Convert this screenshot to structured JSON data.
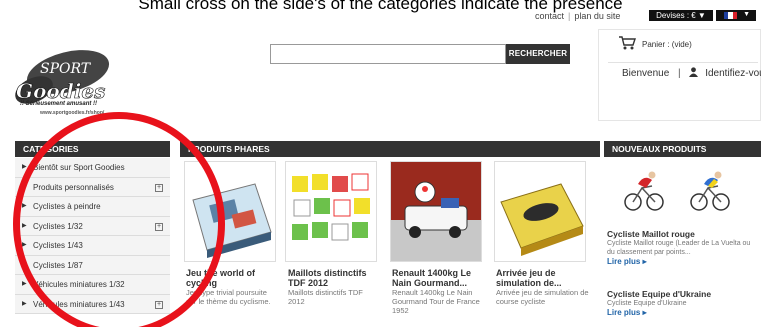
{
  "caption": "Small cross on the side's of the categories indicate the presence",
  "toplinks": {
    "contact": "contact",
    "sep": "|",
    "plan": "plan du site"
  },
  "devises": "Devises : € ▼",
  "search": {
    "placeholder": "",
    "button": "RECHERCHER"
  },
  "cart": {
    "label": "Panier : (vide)",
    "welcome": "Bienvenue",
    "signin": "Identifiez-vous"
  },
  "logo": {
    "line1": "SPORT",
    "line2": "Goodies",
    "tagline": "!! Sérieusement amusant !!",
    "url": "www.sportgoodies.fr/shop/"
  },
  "categories": {
    "title": "CATEGORIES",
    "items": [
      {
        "label": "Bientôt sur Sport Goodies",
        "plus": false
      },
      {
        "label": "Produits personnalisés",
        "plus": true
      },
      {
        "label": "Cyclistes à peindre",
        "plus": false
      },
      {
        "label": "Cyclistes 1/32",
        "plus": true
      },
      {
        "label": "Cyclistes 1/43",
        "plus": false
      },
      {
        "label": "Cyclistes 1/87",
        "plus": false
      },
      {
        "label": "Véhicules miniatures 1/32",
        "plus": false
      },
      {
        "label": "Véhicules miniatures 1/43",
        "plus": true
      }
    ]
  },
  "featured": {
    "title": "PRODUITS PHARES",
    "products": [
      {
        "title": "Jeu the world of cycling",
        "desc": "Jeu type trivial poursuite sur le thème du cyclisme."
      },
      {
        "title": "Maillots distinctifs TDF 2012",
        "desc": "Maillots distinctifs TDF 2012"
      },
      {
        "title": "Renault 1400kg Le Nain Gourmand...",
        "desc": "Renault 1400kg Le Nain Gourmand Tour de France 1952"
      },
      {
        "title": "Arrivée jeu de simulation de...",
        "desc": "Arrivée jeu de simulation de course cycliste"
      }
    ]
  },
  "newproducts": {
    "title": "NOUVEAUX PRODUITS",
    "items": [
      {
        "title": "Cycliste Maillot rouge",
        "desc": "Cycliste Maillot rouge (Leader de La Vuelta ou du classement par points...",
        "more": "Lire plus ▸"
      },
      {
        "title": "Cycliste Equipe d'Ukraine",
        "desc": "Cycliste Equipe d'Ukraine",
        "more": "Lire plus ▸"
      }
    ]
  },
  "colors": {
    "annotation": "#e8121b",
    "header_bg": "#333333",
    "link": "#2265a8"
  }
}
